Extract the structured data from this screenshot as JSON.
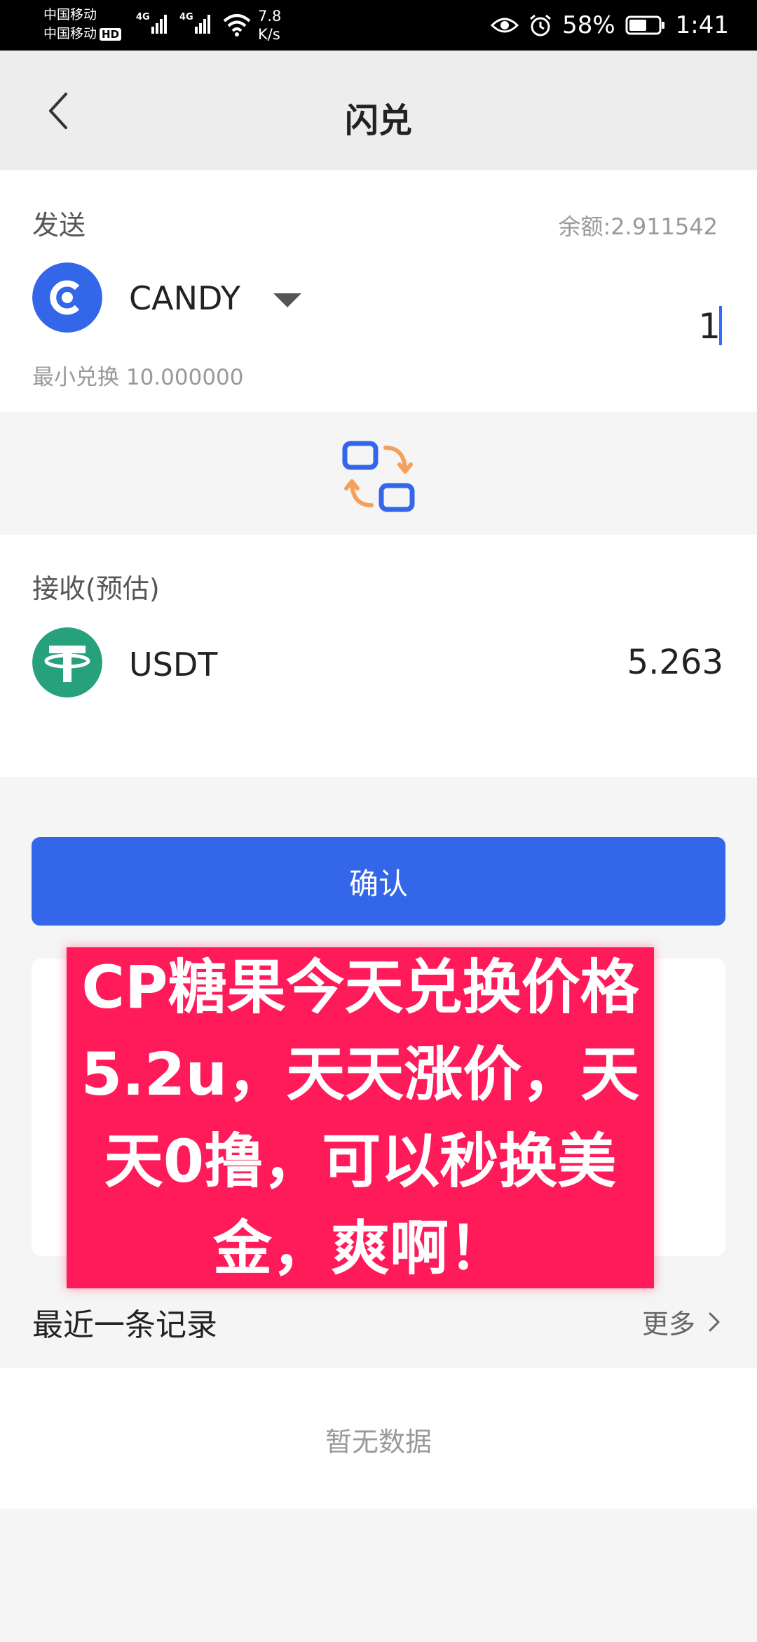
{
  "status_bar": {
    "carrier_1": "中国移动",
    "carrier_2": "中国移动",
    "hd": "HD",
    "net_1": "4G",
    "net_2": "4G",
    "speed_value": "7.8",
    "speed_unit": "K/s",
    "battery": "58%",
    "time": "1:41"
  },
  "header": {
    "title": "闪兑"
  },
  "send": {
    "label": "发送",
    "balance": "余额:2.911542",
    "coin": "CANDY",
    "amount": "1",
    "min_exchange": "最小兑换 10.000000"
  },
  "receive": {
    "label": "接收(预估)",
    "coin": "USDT",
    "amount": "5.263"
  },
  "confirm_label": "确认",
  "overlay_text": "CP糖果今天兑换价格5.2u，天天涨价，天天0撸，可以秒换美金，爽啊！",
  "recent": {
    "title": "最近一条记录",
    "more": "更多",
    "empty": "暂无数据"
  },
  "colors": {
    "primary": "#3366e8",
    "overlay": "#ff1a5a",
    "candy_logo": "#3366e8",
    "usdt_logo": "#26a17b",
    "swap_orange": "#f5a05a"
  }
}
